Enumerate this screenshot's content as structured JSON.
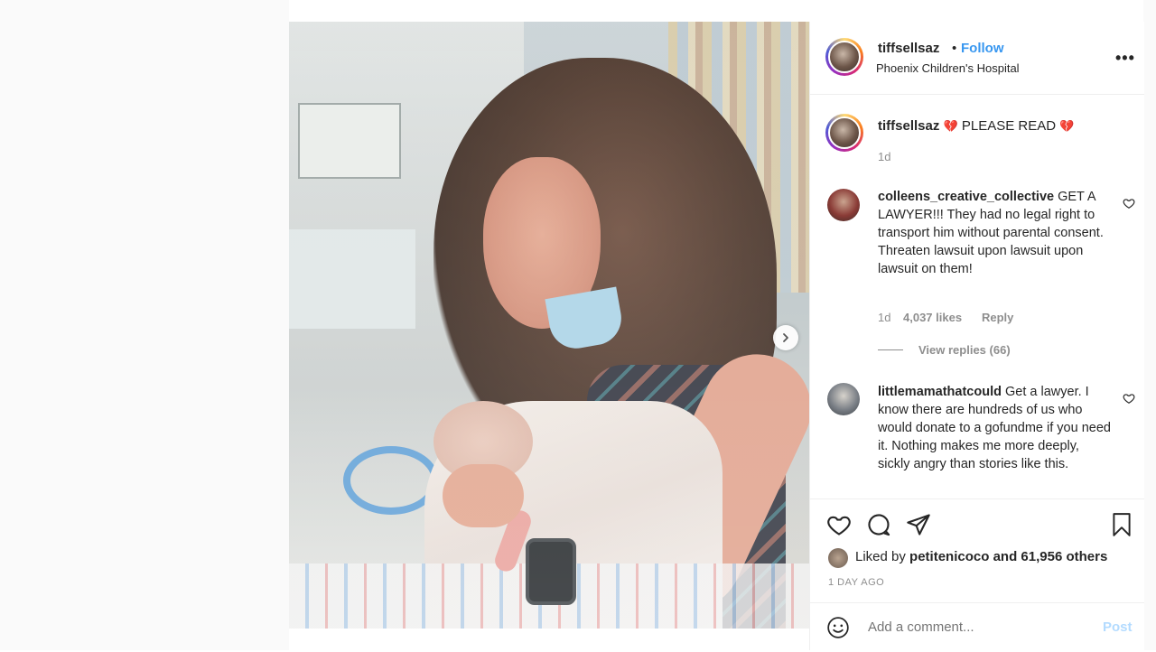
{
  "post": {
    "image_alt": "",
    "next_icon": "chevron-right-icon"
  },
  "header": {
    "username": "tiffsellsaz",
    "separator": "•",
    "follow_label": "Follow",
    "location": "Phoenix Children's Hospital",
    "more_icon": "•••"
  },
  "caption": {
    "username": "tiffsellsaz",
    "text": "PLEASE READ",
    "emoji": "💔",
    "time": "1d"
  },
  "comments": [
    {
      "username": "colleens_creative_collective",
      "text": "GET A LAWYER!!! They had no legal right to transport him without parental consent. Threaten lawsuit upon lawsuit upon lawsuit on them!",
      "time": "1d",
      "likes": "4,037 likes",
      "reply_label": "Reply",
      "view_replies": "View replies (66)"
    },
    {
      "username": "littlemamathatcould",
      "text": "Get a lawyer. I know there are hundreds of us who would donate to a gofundme if you need it. Nothing makes me more deeply, sickly angry than stories like this."
    }
  ],
  "actions": {
    "liked_by_prefix": "Liked by",
    "liked_by_user": "petitenicoco",
    "liked_by_suffix": "and 61,956 others",
    "time_ago": "1 DAY AGO"
  },
  "comment_box": {
    "placeholder": "Add a comment...",
    "post_label": "Post"
  },
  "colors": {
    "link": "#3897f0",
    "muted": "#8e8e8e",
    "post_disabled": "#b3dbff"
  }
}
